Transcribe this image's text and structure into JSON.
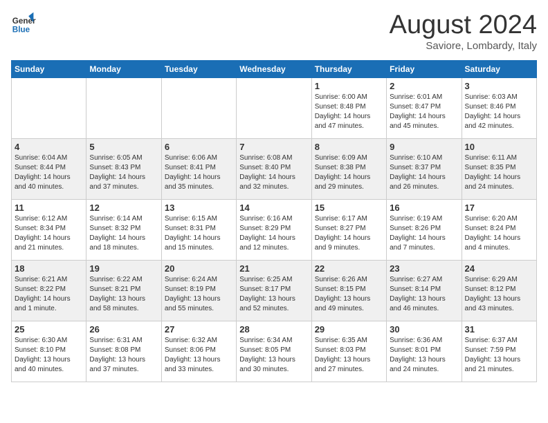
{
  "header": {
    "logo_line1": "General",
    "logo_line2": "Blue",
    "month_year": "August 2024",
    "location": "Saviore, Lombardy, Italy"
  },
  "weekdays": [
    "Sunday",
    "Monday",
    "Tuesday",
    "Wednesday",
    "Thursday",
    "Friday",
    "Saturday"
  ],
  "weeks": [
    [
      {
        "day": "",
        "info": ""
      },
      {
        "day": "",
        "info": ""
      },
      {
        "day": "",
        "info": ""
      },
      {
        "day": "",
        "info": ""
      },
      {
        "day": "1",
        "info": "Sunrise: 6:00 AM\nSunset: 8:48 PM\nDaylight: 14 hours and 47 minutes."
      },
      {
        "day": "2",
        "info": "Sunrise: 6:01 AM\nSunset: 8:47 PM\nDaylight: 14 hours and 45 minutes."
      },
      {
        "day": "3",
        "info": "Sunrise: 6:03 AM\nSunset: 8:46 PM\nDaylight: 14 hours and 42 minutes."
      }
    ],
    [
      {
        "day": "4",
        "info": "Sunrise: 6:04 AM\nSunset: 8:44 PM\nDaylight: 14 hours and 40 minutes."
      },
      {
        "day": "5",
        "info": "Sunrise: 6:05 AM\nSunset: 8:43 PM\nDaylight: 14 hours and 37 minutes."
      },
      {
        "day": "6",
        "info": "Sunrise: 6:06 AM\nSunset: 8:41 PM\nDaylight: 14 hours and 35 minutes."
      },
      {
        "day": "7",
        "info": "Sunrise: 6:08 AM\nSunset: 8:40 PM\nDaylight: 14 hours and 32 minutes."
      },
      {
        "day": "8",
        "info": "Sunrise: 6:09 AM\nSunset: 8:38 PM\nDaylight: 14 hours and 29 minutes."
      },
      {
        "day": "9",
        "info": "Sunrise: 6:10 AM\nSunset: 8:37 PM\nDaylight: 14 hours and 26 minutes."
      },
      {
        "day": "10",
        "info": "Sunrise: 6:11 AM\nSunset: 8:35 PM\nDaylight: 14 hours and 24 minutes."
      }
    ],
    [
      {
        "day": "11",
        "info": "Sunrise: 6:12 AM\nSunset: 8:34 PM\nDaylight: 14 hours and 21 minutes."
      },
      {
        "day": "12",
        "info": "Sunrise: 6:14 AM\nSunset: 8:32 PM\nDaylight: 14 hours and 18 minutes."
      },
      {
        "day": "13",
        "info": "Sunrise: 6:15 AM\nSunset: 8:31 PM\nDaylight: 14 hours and 15 minutes."
      },
      {
        "day": "14",
        "info": "Sunrise: 6:16 AM\nSunset: 8:29 PM\nDaylight: 14 hours and 12 minutes."
      },
      {
        "day": "15",
        "info": "Sunrise: 6:17 AM\nSunset: 8:27 PM\nDaylight: 14 hours and 9 minutes."
      },
      {
        "day": "16",
        "info": "Sunrise: 6:19 AM\nSunset: 8:26 PM\nDaylight: 14 hours and 7 minutes."
      },
      {
        "day": "17",
        "info": "Sunrise: 6:20 AM\nSunset: 8:24 PM\nDaylight: 14 hours and 4 minutes."
      }
    ],
    [
      {
        "day": "18",
        "info": "Sunrise: 6:21 AM\nSunset: 8:22 PM\nDaylight: 14 hours and 1 minute."
      },
      {
        "day": "19",
        "info": "Sunrise: 6:22 AM\nSunset: 8:21 PM\nDaylight: 13 hours and 58 minutes."
      },
      {
        "day": "20",
        "info": "Sunrise: 6:24 AM\nSunset: 8:19 PM\nDaylight: 13 hours and 55 minutes."
      },
      {
        "day": "21",
        "info": "Sunrise: 6:25 AM\nSunset: 8:17 PM\nDaylight: 13 hours and 52 minutes."
      },
      {
        "day": "22",
        "info": "Sunrise: 6:26 AM\nSunset: 8:15 PM\nDaylight: 13 hours and 49 minutes."
      },
      {
        "day": "23",
        "info": "Sunrise: 6:27 AM\nSunset: 8:14 PM\nDaylight: 13 hours and 46 minutes."
      },
      {
        "day": "24",
        "info": "Sunrise: 6:29 AM\nSunset: 8:12 PM\nDaylight: 13 hours and 43 minutes."
      }
    ],
    [
      {
        "day": "25",
        "info": "Sunrise: 6:30 AM\nSunset: 8:10 PM\nDaylight: 13 hours and 40 minutes."
      },
      {
        "day": "26",
        "info": "Sunrise: 6:31 AM\nSunset: 8:08 PM\nDaylight: 13 hours and 37 minutes."
      },
      {
        "day": "27",
        "info": "Sunrise: 6:32 AM\nSunset: 8:06 PM\nDaylight: 13 hours and 33 minutes."
      },
      {
        "day": "28",
        "info": "Sunrise: 6:34 AM\nSunset: 8:05 PM\nDaylight: 13 hours and 30 minutes."
      },
      {
        "day": "29",
        "info": "Sunrise: 6:35 AM\nSunset: 8:03 PM\nDaylight: 13 hours and 27 minutes."
      },
      {
        "day": "30",
        "info": "Sunrise: 6:36 AM\nSunset: 8:01 PM\nDaylight: 13 hours and 24 minutes."
      },
      {
        "day": "31",
        "info": "Sunrise: 6:37 AM\nSunset: 7:59 PM\nDaylight: 13 hours and 21 minutes."
      }
    ]
  ]
}
